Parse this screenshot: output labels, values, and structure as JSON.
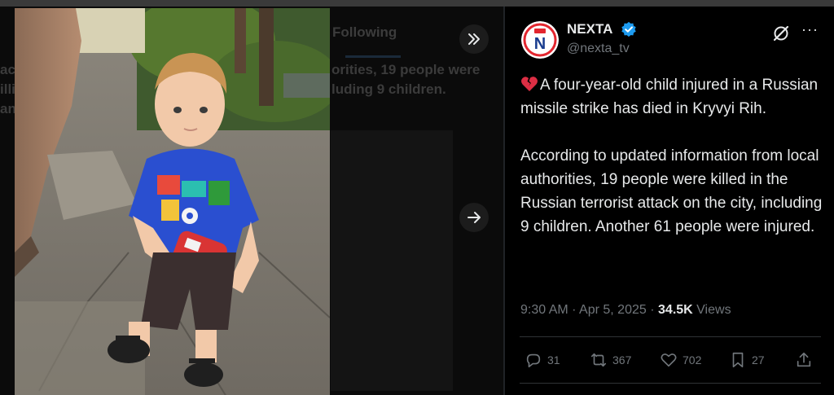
{
  "background": {
    "tab_label": "Following",
    "line1_left": "ac",
    "line1_right": "orities, 19 people were",
    "line2_left": "illi",
    "line2_right": "luding 9 children.",
    "line3_left": "an"
  },
  "nav": {
    "next_media_icon": "chevrons-right-icon",
    "next_post_icon": "arrow-right-icon"
  },
  "author": {
    "name": "NEXTA",
    "handle": "@nexta_tv",
    "verified": true,
    "avatar_letter": "N"
  },
  "tweet": {
    "emoji": "broken-heart",
    "paragraph1": "A four-year-old child injured in a Russian missile strike has died in Kryvyi Rih.",
    "paragraph2": "According to updated information from local authorities, 19 people were killed in the Russian terrorist attack on the city, including 9 children. Another 61 people were injured."
  },
  "meta": {
    "time": "9:30 AM",
    "dot1": "·",
    "date": "Apr 5, 2025",
    "dot2": "·",
    "views": "34.5K",
    "views_label": "Views"
  },
  "actions": {
    "replies": "31",
    "reposts": "367",
    "likes": "702",
    "bookmarks": "27"
  },
  "colors": {
    "accent": "#1d9bf0",
    "text": "#e7e9ea",
    "muted": "#71767b",
    "brand_red": "#e3262f"
  }
}
